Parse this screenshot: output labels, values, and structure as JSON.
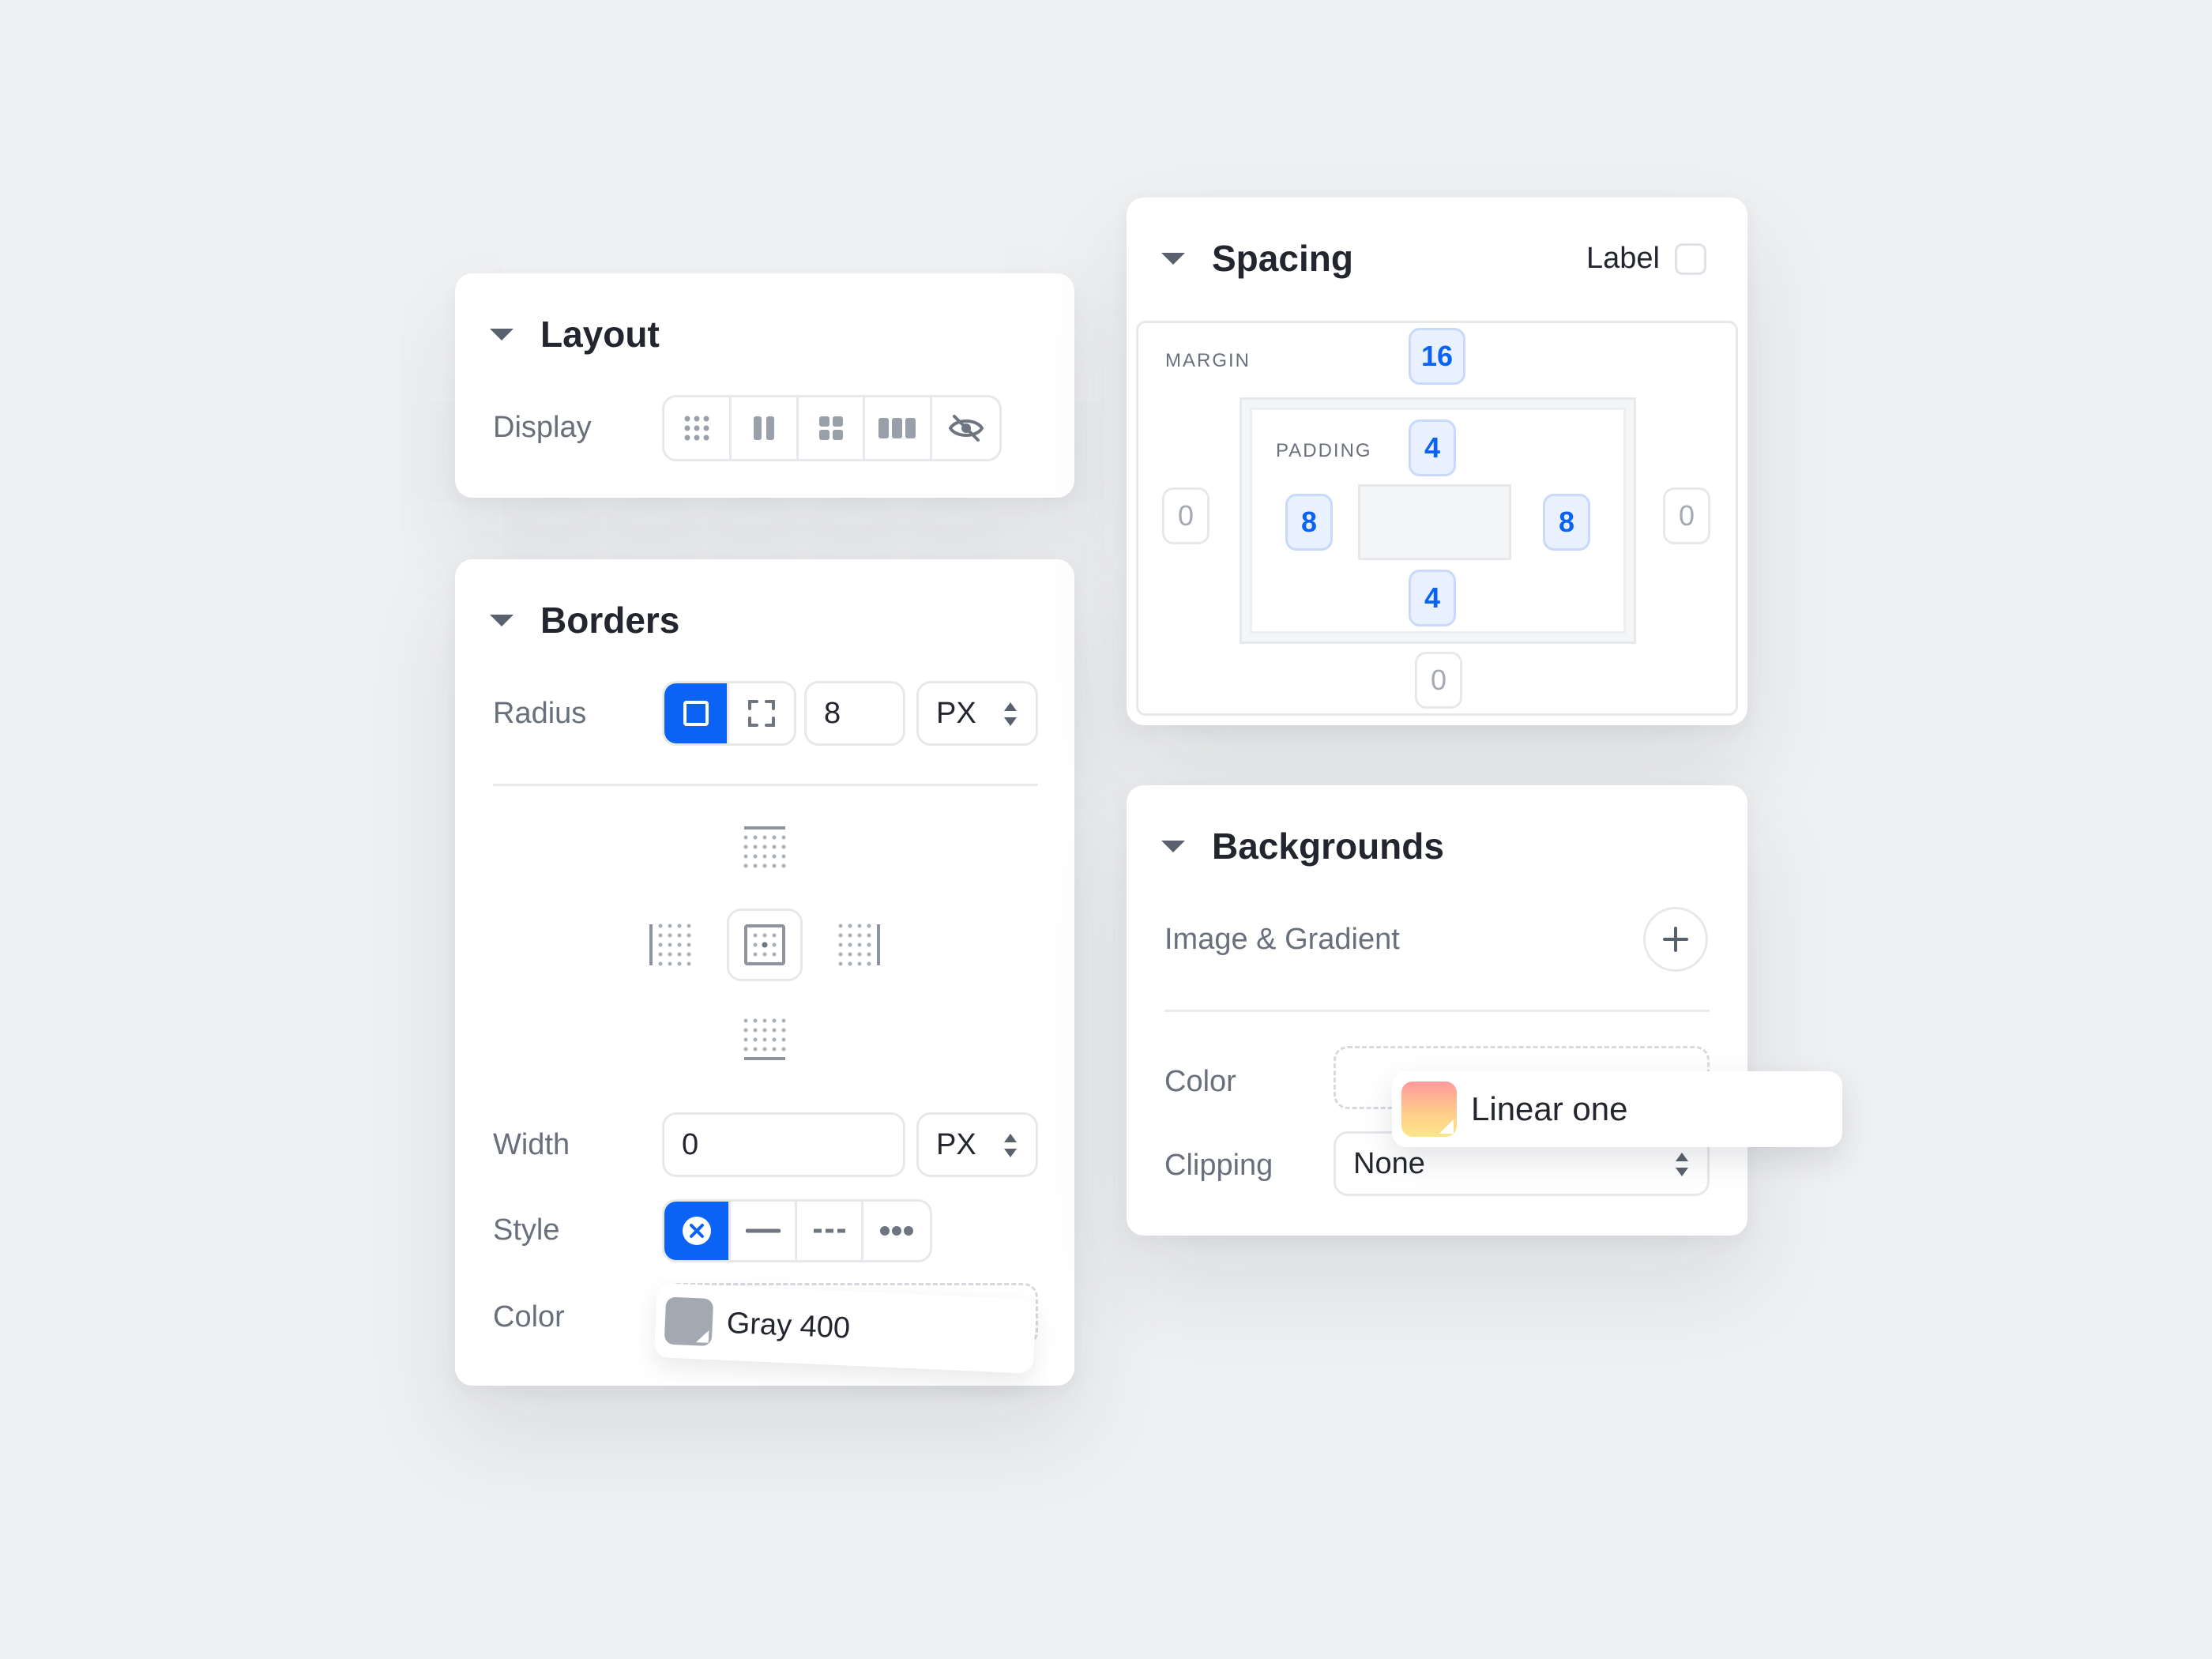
{
  "layout": {
    "title": "Layout",
    "display_label": "Display",
    "display_options": [
      "grid-dots-icon",
      "columns-two-icon",
      "grid-four-icon",
      "columns-three-icon",
      "eye-off-icon"
    ]
  },
  "borders": {
    "title": "Borders",
    "radius_label": "Radius",
    "radius_value": "8",
    "radius_unit": "PX",
    "width_label": "Width",
    "width_value": "0",
    "width_unit": "PX",
    "style_label": "Style",
    "color_label": "Color",
    "color_value": "Gray 400",
    "color_swatch": "#a3a8b2"
  },
  "spacing": {
    "title": "Spacing",
    "label_toggle": "Label",
    "margin_label": "MARGIN",
    "padding_label": "PADDING",
    "margin_top": "16",
    "margin_left": "0",
    "margin_right": "0",
    "margin_bottom": "0",
    "padding_top": "4",
    "padding_left": "8",
    "padding_right": "8",
    "padding_bottom": "4"
  },
  "backgrounds": {
    "title": "Backgrounds",
    "image_gradient_label": "Image & Gradient",
    "color_label": "Color",
    "color_value": "Linear one",
    "clipping_label": "Clipping",
    "clipping_value": "None"
  },
  "colors": {
    "accent": "#0b63f6",
    "chip_bg": "#eaf1fe",
    "text": "#23262e",
    "muted": "#6a707b"
  }
}
